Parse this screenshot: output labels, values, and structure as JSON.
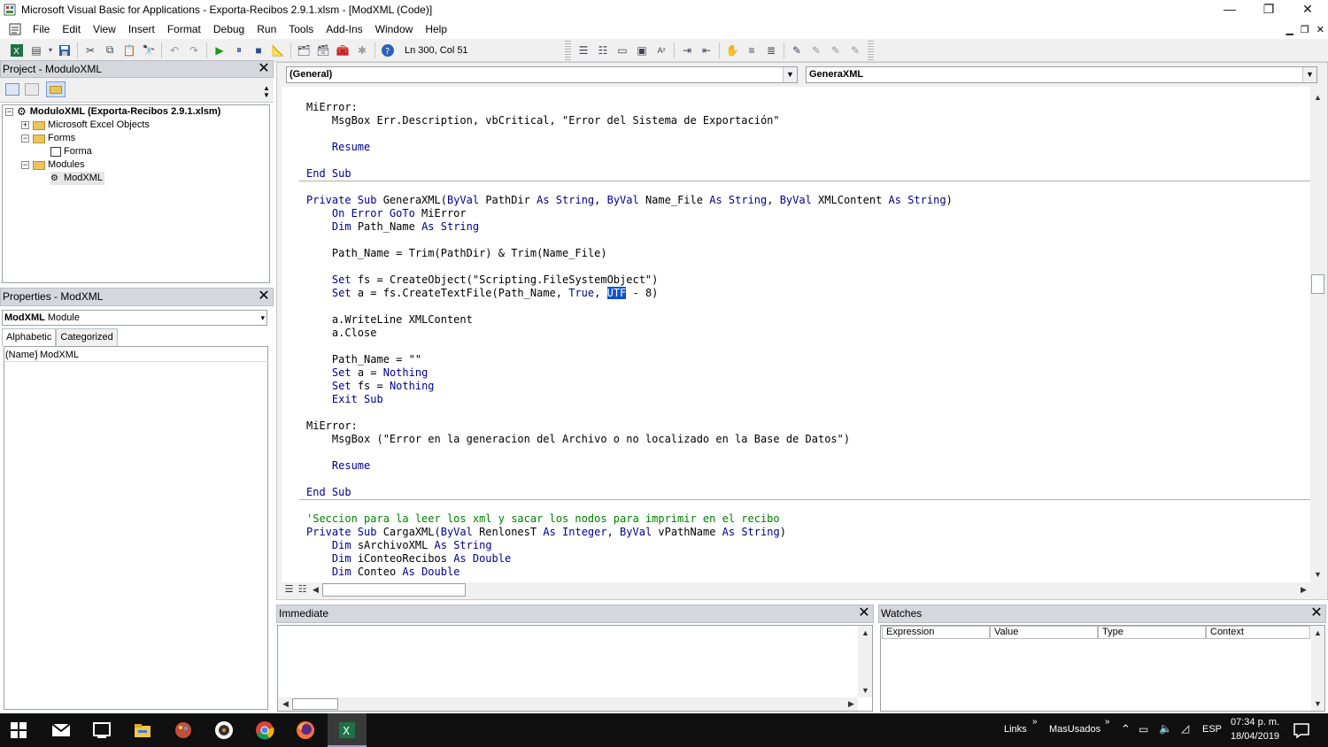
{
  "window": {
    "title": "Microsoft Visual Basic for Applications - Exporta-Recibos 2.9.1.xlsm - [ModXML (Code)]",
    "minimize_glyph": "—",
    "restore_glyph": "❐",
    "close_glyph": "✕"
  },
  "menu": [
    "File",
    "Edit",
    "View",
    "Insert",
    "Format",
    "Debug",
    "Run",
    "Tools",
    "Add-Ins",
    "Window",
    "Help"
  ],
  "toolbar": {
    "position": "Ln 300, Col 51"
  },
  "project": {
    "title": "Project - ModuloXML",
    "tree": [
      {
        "label": "ModuloXML (Exporta-Recibos 2.9.1.xlsm)",
        "bold": true
      },
      {
        "label": "Microsoft Excel Objects"
      },
      {
        "label": "Forms"
      },
      {
        "label": "Forma"
      },
      {
        "label": "Modules"
      },
      {
        "label": "ModXML"
      }
    ]
  },
  "properties": {
    "title": "Properties - ModXML",
    "object_name": "ModXML",
    "object_type": "Module",
    "tabs": [
      "Alphabetic",
      "Categorized"
    ],
    "rows": [
      {
        "key": "(Name)",
        "value": "ModXML"
      }
    ]
  },
  "code_window": {
    "object_combo": "(General)",
    "procedure_combo": "GeneraXML"
  },
  "immediate": {
    "title": "Immediate"
  },
  "watches": {
    "title": "Watches",
    "columns": [
      "Expression",
      "Value",
      "Type",
      "Context"
    ]
  },
  "taskbar": {
    "links": "Links",
    "masusados": "MasUsados",
    "lang": "ESP",
    "time": "07:34 p. m.",
    "date": "18/04/2019"
  },
  "colors": {
    "keyword": "#00008b",
    "comment": "#008000",
    "selection": "#0a53d0"
  }
}
